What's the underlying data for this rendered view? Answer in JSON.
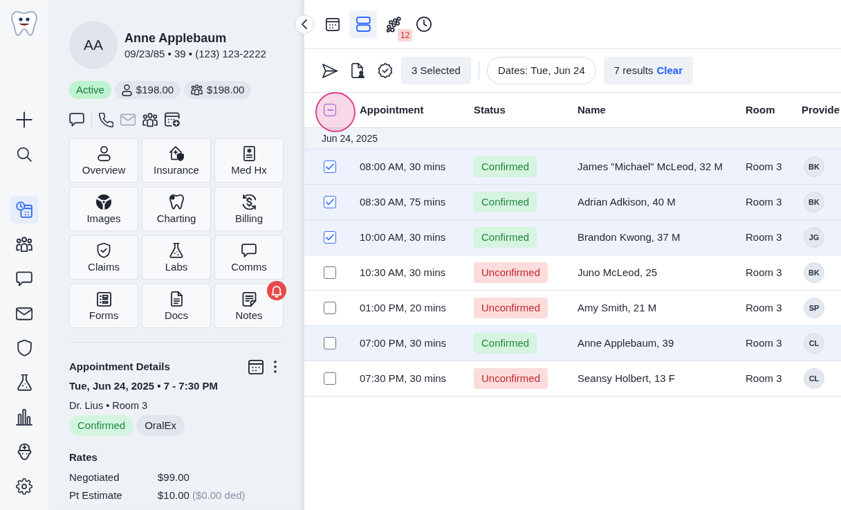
{
  "rail": {
    "nav": [
      {
        "selected": true
      },
      {
        "selected": false
      },
      {
        "selected": false
      },
      {
        "selected": false
      },
      {
        "selected": false
      },
      {
        "selected": false
      },
      {
        "selected": false
      },
      {
        "selected": false
      },
      {
        "selected": false
      }
    ]
  },
  "patient": {
    "initials": "AA",
    "name": "Anne Applebaum",
    "details": "09/23/85 • 39 • (123) 123-2222",
    "badges": [
      {
        "kind": "status",
        "text": "Active"
      },
      {
        "kind": "patient_balance",
        "text": "$198.00"
      },
      {
        "kind": "family_balance",
        "text": "$198.00"
      }
    ],
    "contact_actions": [
      {
        "disabled": false
      },
      {
        "disabled": false
      },
      {
        "disabled": true
      },
      {
        "disabled": false
      },
      {
        "disabled": false
      }
    ],
    "tiles": [
      {
        "label": "Overview",
        "alert": false
      },
      {
        "label": "Insurance",
        "alert": false
      },
      {
        "label": "Med Hx",
        "alert": false
      },
      {
        "label": "Images",
        "alert": false
      },
      {
        "label": "Charting",
        "alert": false
      },
      {
        "label": "Billing",
        "alert": false
      },
      {
        "label": "Claims",
        "alert": false
      },
      {
        "label": "Labs",
        "alert": false
      },
      {
        "label": "Comms",
        "alert": false
      },
      {
        "label": "Forms",
        "alert": false
      },
      {
        "label": "Docs",
        "alert": false
      },
      {
        "label": "Notes",
        "alert": true
      }
    ]
  },
  "appointment": {
    "title": "Appointment Details",
    "when": "Tue, Jun 24, 2025 • 7 - 7:30 PM",
    "where": "Dr. Lius • Room 3",
    "tags": [
      {
        "kind": "confirmed",
        "text": "Confirmed"
      },
      {
        "kind": "type",
        "text": "OralEx"
      }
    ],
    "rates_title": "Rates",
    "rates": [
      {
        "label": "Negotiated",
        "value": "$99.00"
      },
      {
        "label": "Pt Estimate",
        "value": "$10.00",
        "note": "($0.00 ded)"
      }
    ]
  },
  "view_tabs": [
    {
      "selected": false
    },
    {
      "selected": true
    },
    {
      "selected": false,
      "badge": "12"
    },
    {
      "selected": false
    }
  ],
  "toolbar": {
    "selected_count": "3 Selected",
    "date_filter": "Dates: Tue, Jun 24",
    "results": "7 results",
    "clear": "Clear"
  },
  "table": {
    "select_all": {
      "indeterminate": true,
      "spotlight": true
    },
    "columns": [
      "Appointment",
      "Status",
      "Name",
      "Room",
      "Provide"
    ],
    "groups": [
      {
        "label": "Jun 24, 2025",
        "rows": [
          {
            "checked": true,
            "highlighted": true,
            "time": "08:00 AM, 30 mins",
            "status": {
              "kind": "confirmed",
              "text": "Confirmed"
            },
            "name": "James \"Michael\" McLeod, 32 M",
            "room": "Room 3",
            "provider": "BK"
          },
          {
            "checked": true,
            "highlighted": true,
            "time": "08:30 AM, 75 mins",
            "status": {
              "kind": "confirmed",
              "text": "Confirmed"
            },
            "name": "Adrian Adkison, 40 M",
            "room": "Room 3",
            "provider": "BK"
          },
          {
            "checked": true,
            "highlighted": true,
            "time": "10:00 AM, 30 mins",
            "status": {
              "kind": "confirmed",
              "text": "Confirmed"
            },
            "name": "Brandon Kwong, 37 M",
            "room": "Room 3",
            "provider": "JG"
          },
          {
            "checked": false,
            "highlighted": false,
            "time": "10:30 AM, 30 mins",
            "status": {
              "kind": "unconfirmed",
              "text": "Unconfirmed"
            },
            "name": "Juno McLeod, 25",
            "room": "Room 3",
            "provider": "BK"
          },
          {
            "checked": false,
            "highlighted": false,
            "time": "01:00 PM, 20 mins",
            "status": {
              "kind": "unconfirmed",
              "text": "Unconfirmed"
            },
            "name": "Amy Smith, 21 M",
            "room": "Room 3",
            "provider": "SP"
          },
          {
            "checked": false,
            "highlighted": true,
            "time": "07:00 PM, 30 mins",
            "status": {
              "kind": "confirmed",
              "text": "Confirmed"
            },
            "name": "Anne Applebaum, 39",
            "room": "Room 3",
            "provider": "CL"
          },
          {
            "checked": false,
            "highlighted": false,
            "time": "07:30 PM, 30 mins",
            "status": {
              "kind": "unconfirmed",
              "text": "Unconfirmed"
            },
            "name": "Seansy Holbert, 13 F",
            "room": "Room 3",
            "provider": "CL"
          }
        ]
      }
    ]
  }
}
